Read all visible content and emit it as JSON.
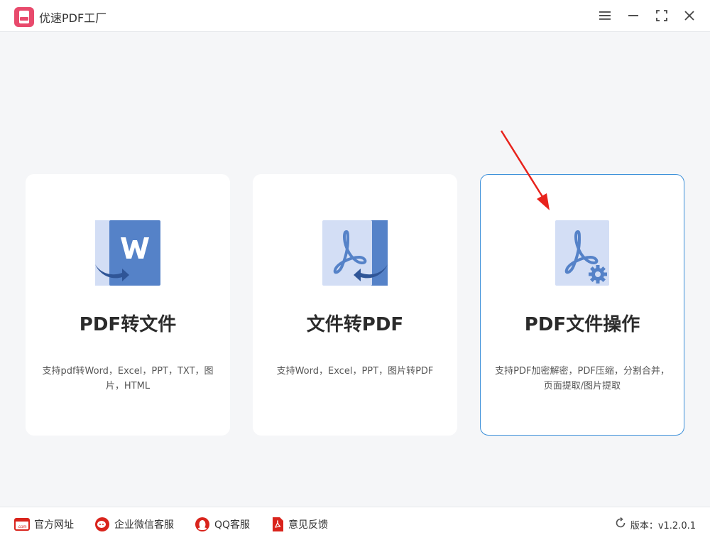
{
  "window": {
    "title": "优速PDF工厂",
    "controls": [
      "menu",
      "minimize",
      "maximize",
      "close"
    ]
  },
  "cards": [
    {
      "title": "PDF转文件",
      "description": "支持pdf转Word，Excel，PPT，TXT，图片，HTML",
      "icon": "pdf-to-word-icon"
    },
    {
      "title": "文件转PDF",
      "description": "支持Word，Excel，PPT，图片转PDF",
      "icon": "file-to-pdf-icon"
    },
    {
      "title": "PDF文件操作",
      "description": "支持PDF加密解密，PDF压缩，分割合并，页面提取/图片提取",
      "icon": "pdf-settings-icon",
      "selected": true
    }
  ],
  "footer": {
    "links": [
      {
        "label": "官方网址",
        "icon": "website-icon"
      },
      {
        "label": "企业微信客服",
        "icon": "wechat-work-icon"
      },
      {
        "label": "QQ客服",
        "icon": "qq-icon"
      },
      {
        "label": "意见反馈",
        "icon": "feedback-icon"
      }
    ],
    "version_label": "版本：v1.2.0.1"
  },
  "colors": {
    "accent": "#3b8fd9",
    "brand": "#e84a6c",
    "icon_blue": "#5582c8",
    "icon_light": "#d3def5",
    "arrow_red": "#e8231c"
  }
}
